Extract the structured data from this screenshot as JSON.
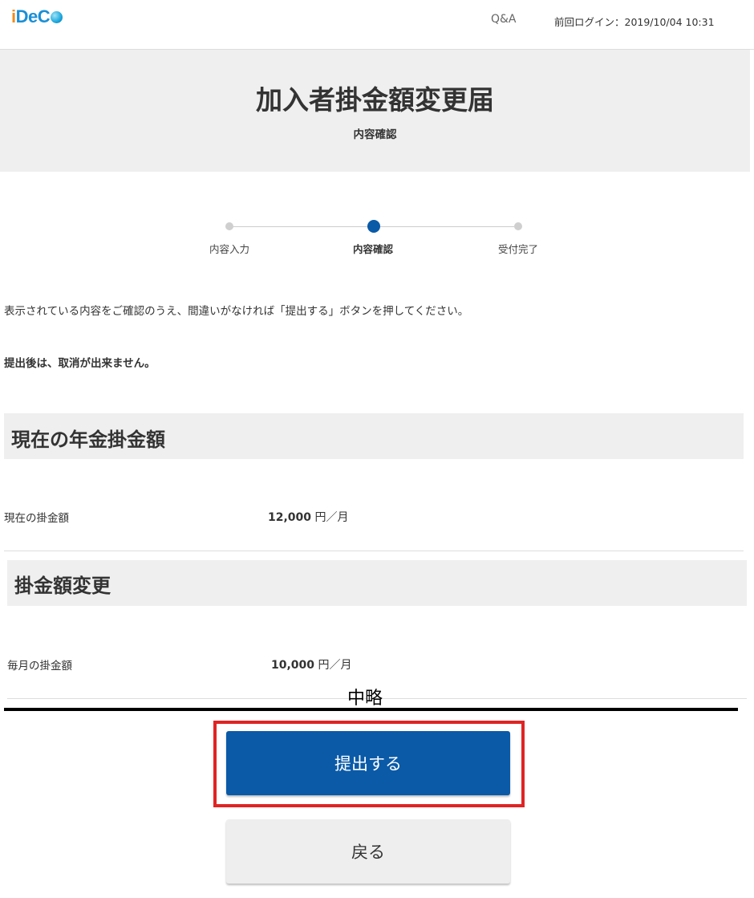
{
  "header": {
    "logo_text": "iDeCo",
    "qa_link": "Q&A",
    "last_login": "前回ログイン：2019/10/04 10:31"
  },
  "page": {
    "title": "加入者掛金額変更届",
    "subtitle": "内容確認"
  },
  "stepper": {
    "steps": [
      {
        "label": "内容入力",
        "state": "done"
      },
      {
        "label": "内容確認",
        "state": "current"
      },
      {
        "label": "受付完了",
        "state": "pending"
      }
    ]
  },
  "instructions": "表示されている内容をご確認のうえ、間違いがなければ「提出する」ボタンを押してください。",
  "warning": "提出後は、取消が出来ません。",
  "sections": [
    {
      "heading": "現在の年金掛金額",
      "row_label": "現在の掛金額",
      "amount": "12,000",
      "unit": "円／月"
    },
    {
      "heading": "掛金額変更",
      "row_label": "毎月の掛金額",
      "amount": "10,000",
      "unit": "円／月"
    }
  ],
  "omission_label": "中略",
  "buttons": {
    "submit": "提出する",
    "back": "戻る"
  },
  "colors": {
    "primary": "#0a5aa8",
    "highlight_border": "#e02424",
    "band_bg": "#efefef"
  }
}
